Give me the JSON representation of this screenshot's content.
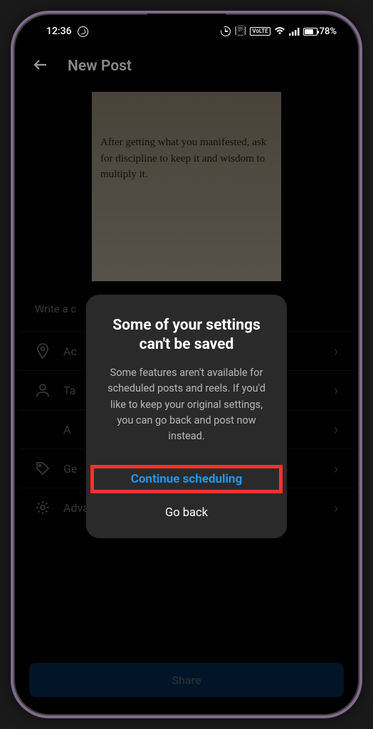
{
  "status": {
    "time": "12:36",
    "battery_pct": "78%"
  },
  "header": {
    "title": "New Post"
  },
  "post_image": {
    "text": "After getting what you manifested, ask for discipline to keep it and wisdom to multiply it."
  },
  "caption": {
    "placeholder": "Write a c"
  },
  "options": {
    "location": "Ac",
    "tag": "Ta",
    "audience": "A",
    "reminder": "Ge",
    "advanced": "Advanced settings"
  },
  "share": {
    "label": "Share"
  },
  "dialog": {
    "title": "Some of your settings can't be saved",
    "body": "Some features aren't available for scheduled posts and reels. If you'd like to keep your original settings, you can go back and post now instead.",
    "primary": "Continue scheduling",
    "secondary": "Go back"
  }
}
